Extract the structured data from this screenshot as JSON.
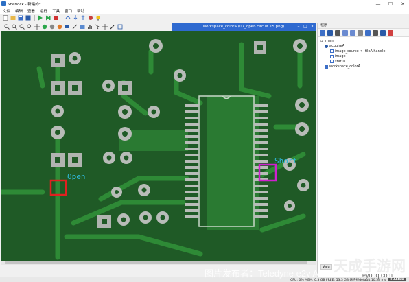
{
  "window": {
    "title": "Sherlock - 新建的*",
    "minimize": "—",
    "maximize": "☐",
    "close": "✕"
  },
  "menu": [
    "文件",
    "编辑",
    "查看",
    "运行",
    "工具",
    "窗口",
    "帮助"
  ],
  "image_window": {
    "title": "workspace_colorA (07_open circuit 15.png)"
  },
  "annotations": {
    "open_label": "Open",
    "short_label": "Short"
  },
  "panel": {
    "header": "程序",
    "tree": [
      {
        "label": "main",
        "level": 0,
        "icon": "folder-icon"
      },
      {
        "label": "acquireA",
        "level": 1,
        "icon": "camera-icon"
      },
      {
        "label": "image_source <- fileA.handle",
        "level": 2,
        "icon": "link-icon"
      },
      {
        "label": "image",
        "level": 2,
        "icon": "image-icon"
      },
      {
        "label": "status",
        "level": 2,
        "icon": "status-icon"
      },
      {
        "label": "workspace_colorA",
        "level": 1,
        "icon": "workspace-icon"
      }
    ],
    "label_stub": "Valu"
  },
  "status": {
    "text": "CPU: 0% MEM: 0.3 GB FREE: 53.3 GB 未连接default 10.58 ms",
    "state": "HALTED"
  },
  "watermark": {
    "line1": "图片发布者：Teledyne e2v Asia",
    "line2": "天成手游网",
    "line3": "eyuqq.com"
  },
  "colors": {
    "pcb": "#1f5a26",
    "trace": "#2e8a36",
    "pad": "#c0c0c0",
    "open_box": "#e02020",
    "short_box": "#d020d0",
    "label": "#2fb6d6",
    "title_blue": "#2f6ad0"
  }
}
